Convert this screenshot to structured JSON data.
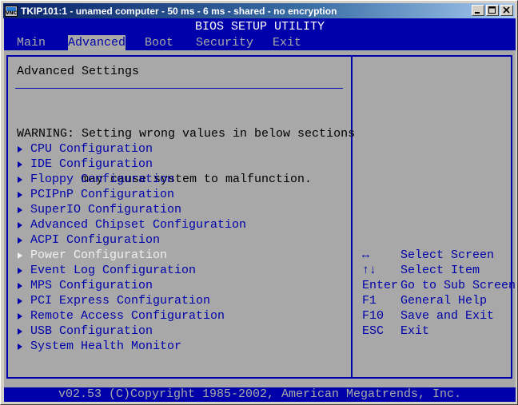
{
  "window": {
    "title": "TKIP101:1 - unamed computer - 50 ms - 6 ms - shared - no encryption",
    "icon_text": "VNC"
  },
  "bios": {
    "header": "BIOS SETUP UTILITY",
    "tabs": [
      {
        "label": "Main",
        "active": false
      },
      {
        "label": "Advanced",
        "active": true
      },
      {
        "label": "Boot",
        "active": false
      },
      {
        "label": "Security",
        "active": false
      },
      {
        "label": "Exit",
        "active": false
      }
    ],
    "section_title": "Advanced Settings",
    "warning_line1": "WARNING: Setting wrong values in below sections",
    "warning_line2": "         may cause system to malfunction.",
    "items": [
      {
        "label": "CPU Configuration",
        "selected": false
      },
      {
        "label": "IDE Configuration",
        "selected": false
      },
      {
        "label": "Floppy Configuration",
        "selected": false
      },
      {
        "label": "PCIPnP Configuration",
        "selected": false
      },
      {
        "label": "SuperIO Configuration",
        "selected": false
      },
      {
        "label": "Advanced Chipset Configuration",
        "selected": false
      },
      {
        "label": "ACPI Configuration",
        "selected": false
      },
      {
        "label": "Power Configuration",
        "selected": true
      },
      {
        "label": "Event Log Configuration",
        "selected": false
      },
      {
        "label": "MPS Configuration",
        "selected": false
      },
      {
        "label": "PCI Express Configuration",
        "selected": false
      },
      {
        "label": "Remote Access Configuration",
        "selected": false
      },
      {
        "label": "USB Configuration",
        "selected": false
      },
      {
        "label": "System Health Monitor",
        "selected": false
      }
    ],
    "help": [
      {
        "key": "↔",
        "desc": "Select Screen"
      },
      {
        "key": "↑↓",
        "desc": "Select Item"
      },
      {
        "key": "Enter",
        "desc": "Go to Sub Screen"
      },
      {
        "key": "F1",
        "desc": "General Help"
      },
      {
        "key": "F10",
        "desc": "Save and Exit"
      },
      {
        "key": "ESC",
        "desc": "Exit"
      }
    ],
    "footer": "v02.53 (C)Copyright 1985-2002, American Megatrends, Inc."
  },
  "colors": {
    "bios_blue": "#0000aa",
    "bios_gray": "#a8a8a8",
    "highlight_white": "#f0f0f0"
  }
}
